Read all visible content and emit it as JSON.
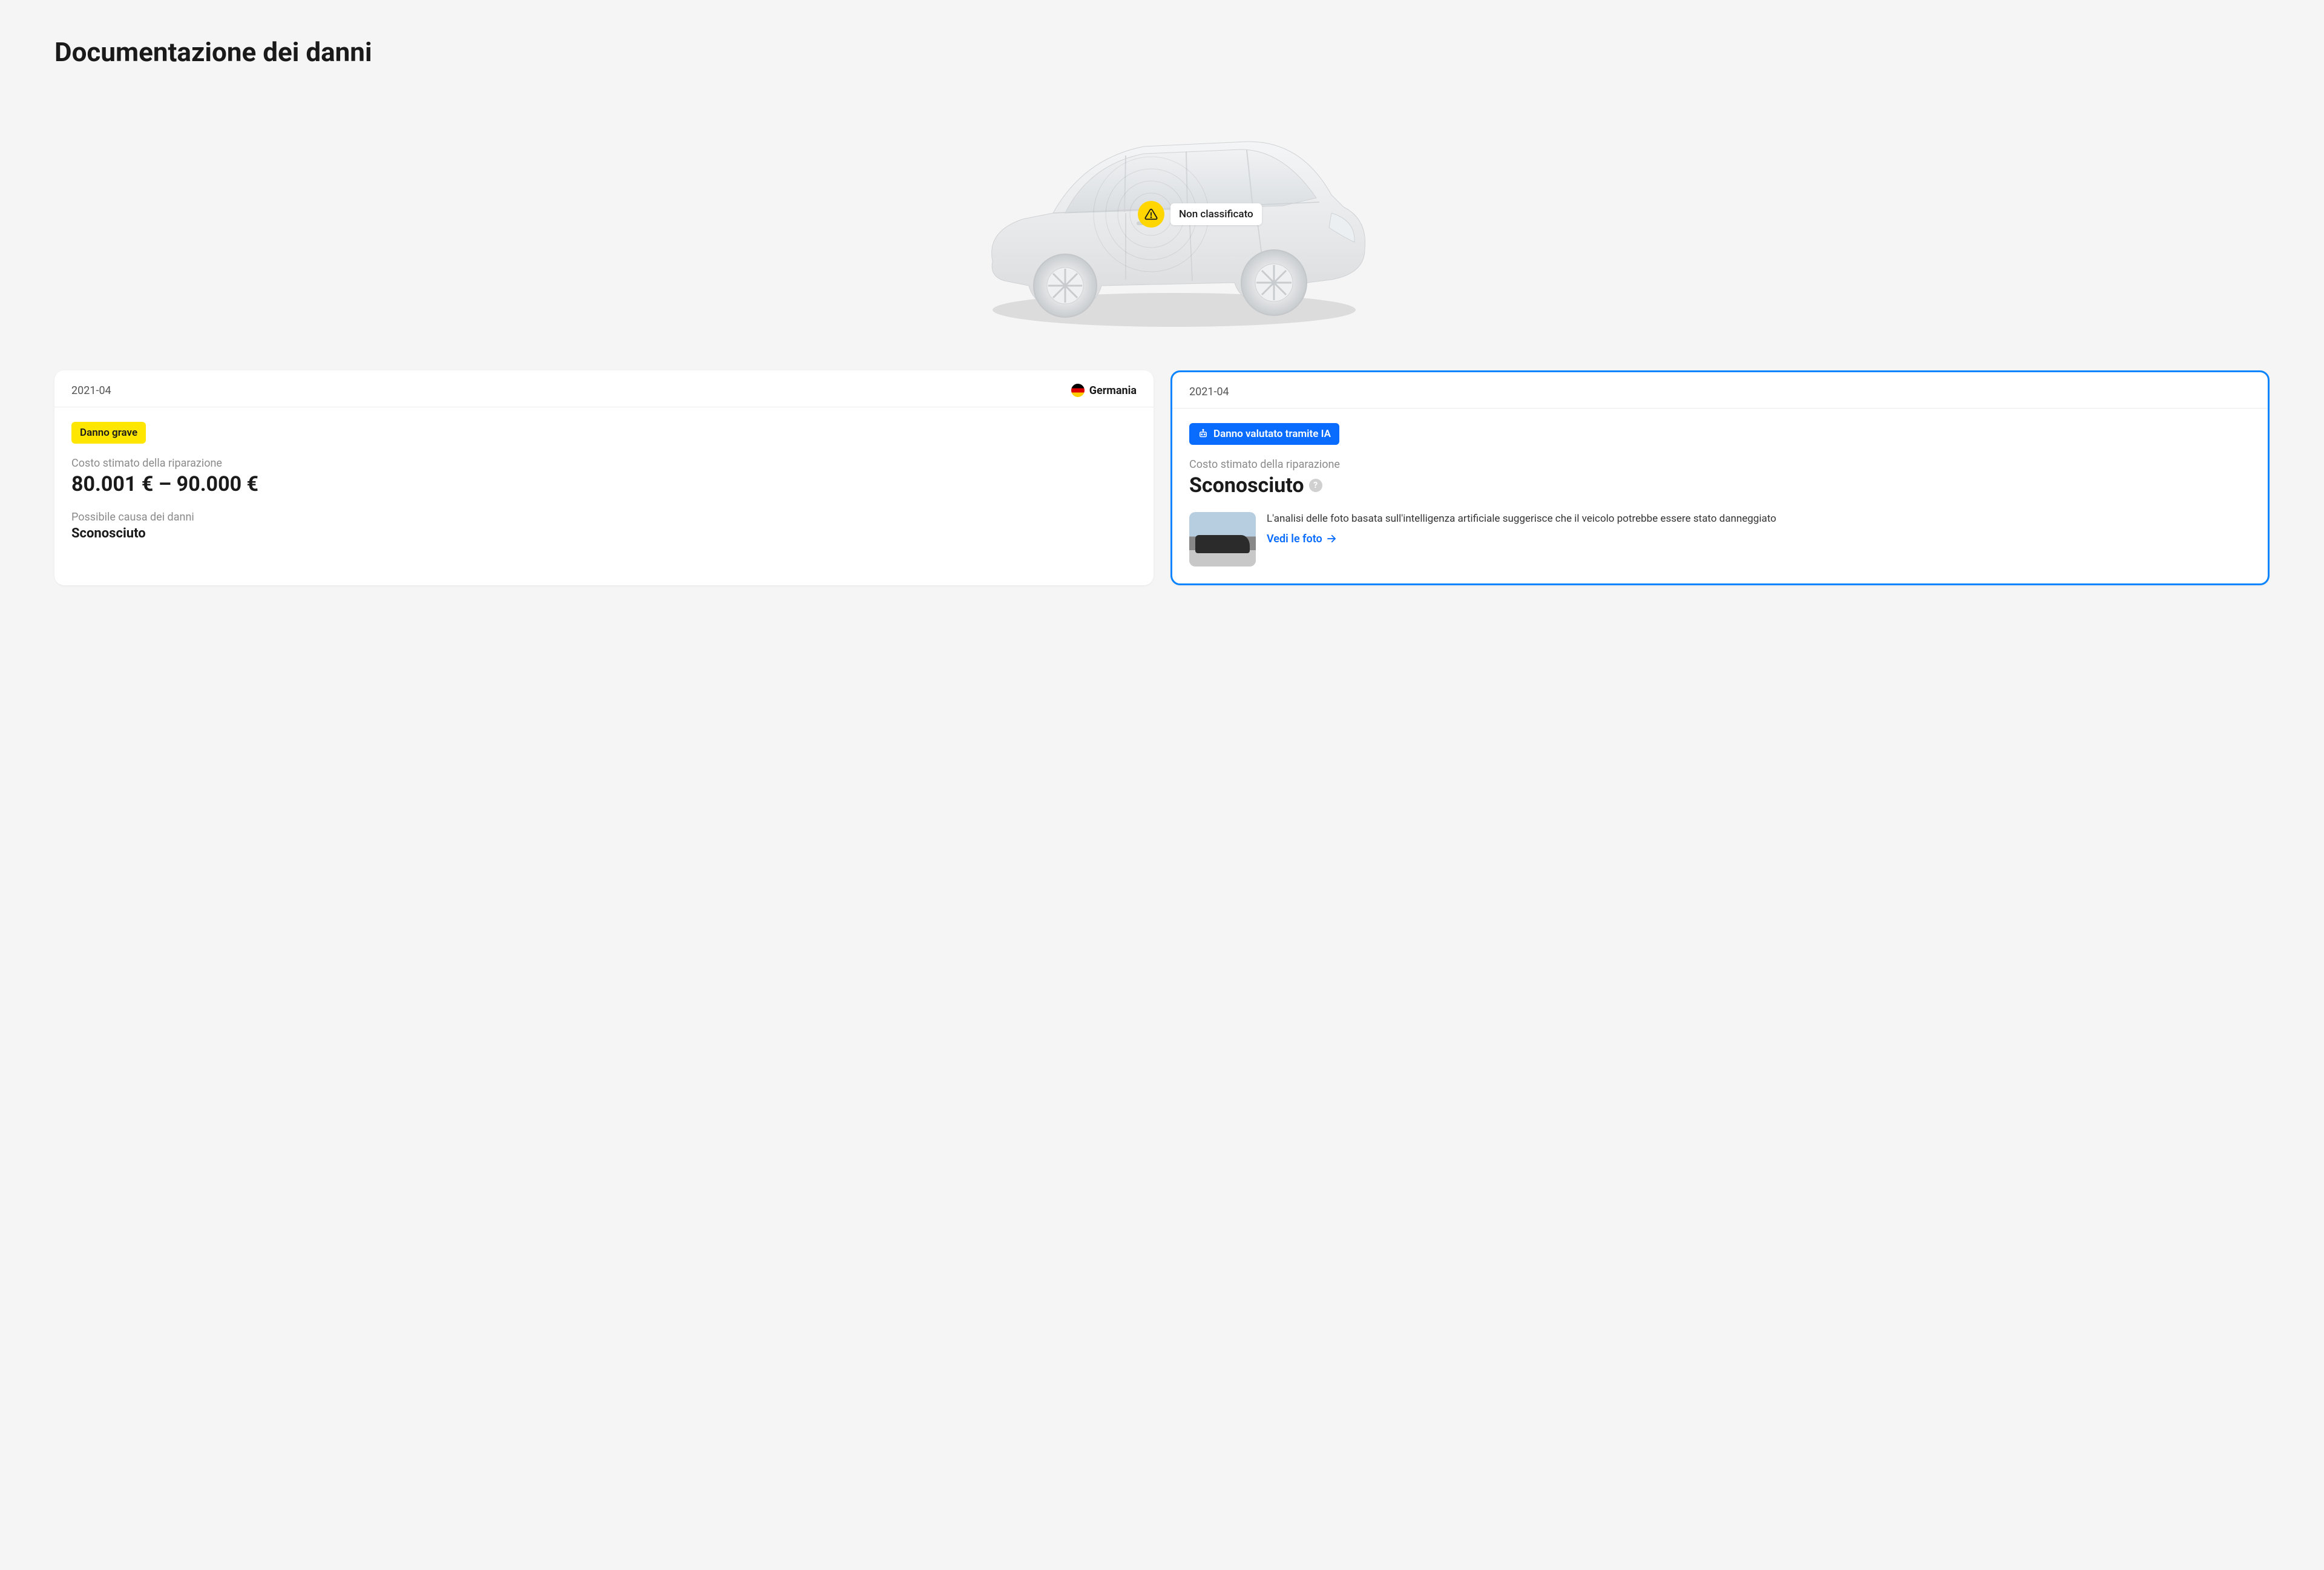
{
  "title": "Documentazione dei danni",
  "marker": {
    "label": "Non classificato"
  },
  "card1": {
    "date": "2021-04",
    "country": "Germania",
    "badge": "Danno grave",
    "cost_label": "Costo stimato della riparazione",
    "cost_value": "80.001 € – 90.000 €",
    "cause_label": "Possibile causa dei danni",
    "cause_value": "Sconosciuto"
  },
  "card2": {
    "date": "2021-04",
    "badge": "Danno valutato tramite IA",
    "cost_label": "Costo stimato della riparazione",
    "cost_value": "Sconosciuto",
    "ai_text": "L'analisi delle foto basata sull'intelligenza artificiale suggerisce che il veicolo potrebbe essere stato danneggiato",
    "link": "Vedi le foto"
  }
}
